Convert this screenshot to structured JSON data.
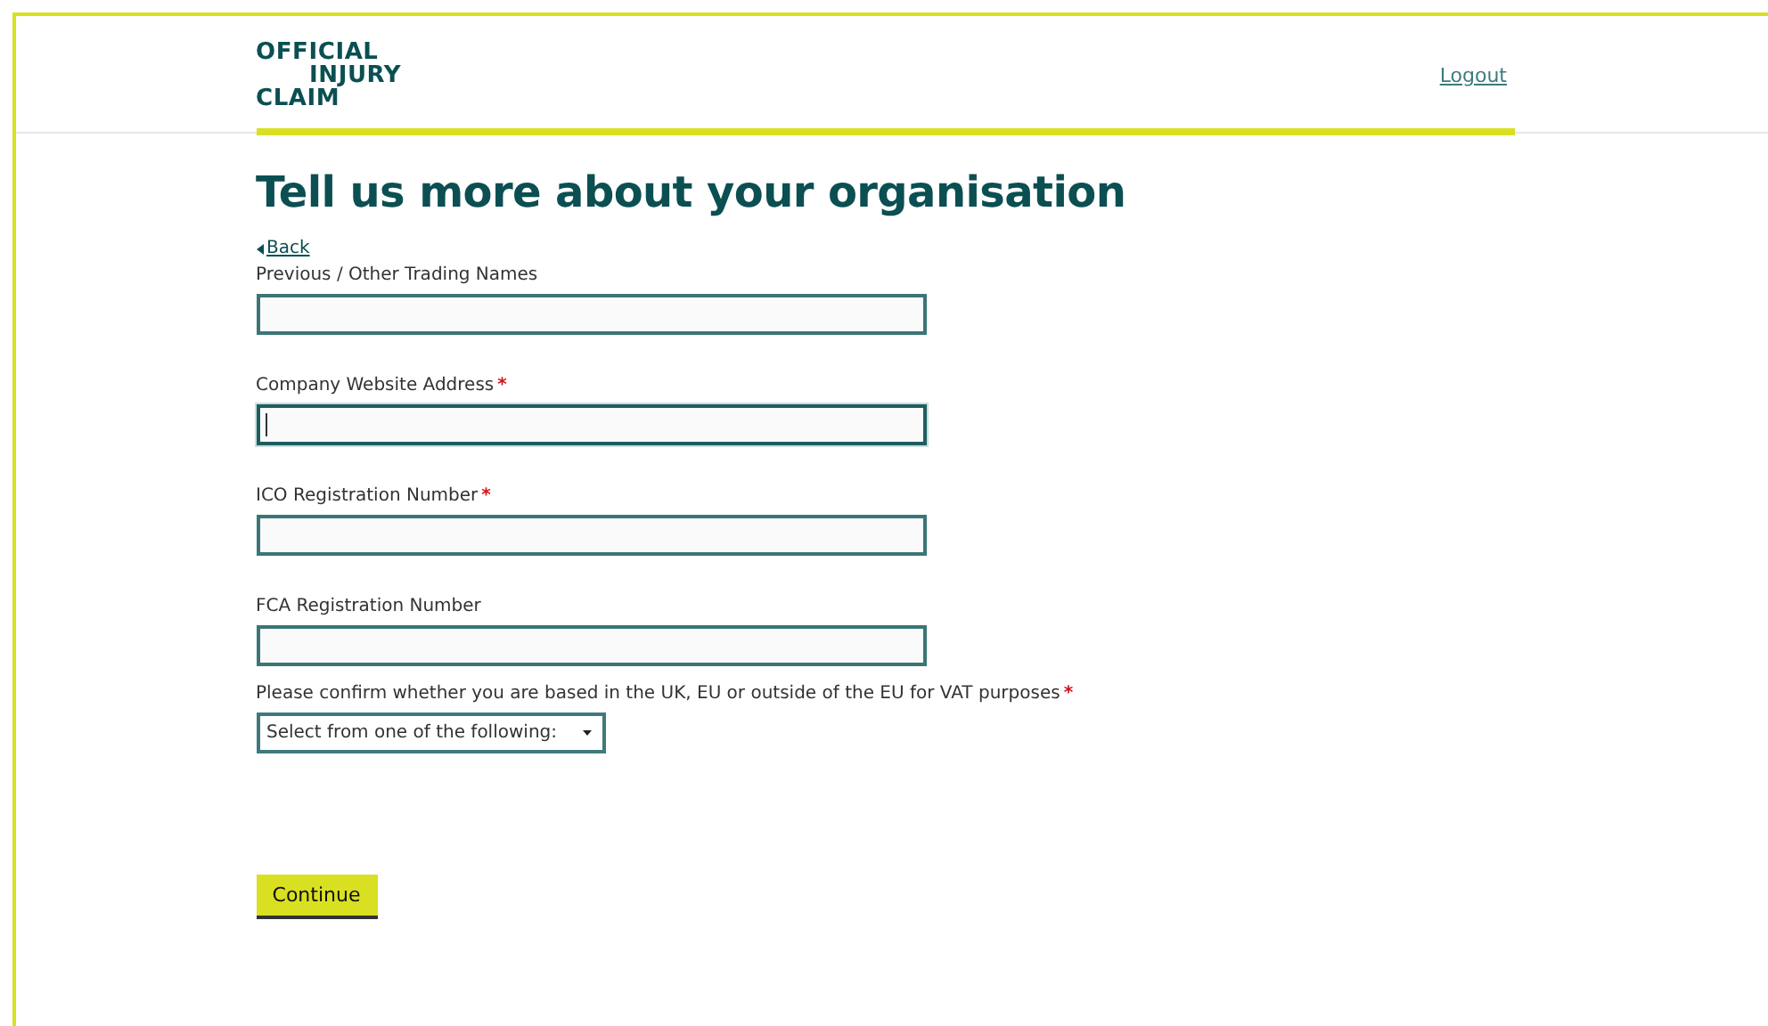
{
  "logo": {
    "lines": [
      "OFFICIAL",
      "INJURY",
      "CLAIM"
    ]
  },
  "header": {
    "logout": "Logout"
  },
  "title": "Tell us more about your organisation",
  "back": "Back",
  "fields": [
    {
      "label": "Previous / Other Trading Names",
      "required": false,
      "focused": false
    },
    {
      "label": "Company Website Address",
      "required": true,
      "focused": true
    },
    {
      "label": "ICO Registration Number",
      "required": true,
      "focused": false
    },
    {
      "label": "FCA Registration Number",
      "required": false,
      "focused": false
    }
  ],
  "vat": {
    "label": "Please confirm whether you are based in the UK, EU or outside of the EU for VAT purposes",
    "required": true,
    "value": "Select from one of the following:"
  },
  "continue": "Continue",
  "required_mark": "*"
}
